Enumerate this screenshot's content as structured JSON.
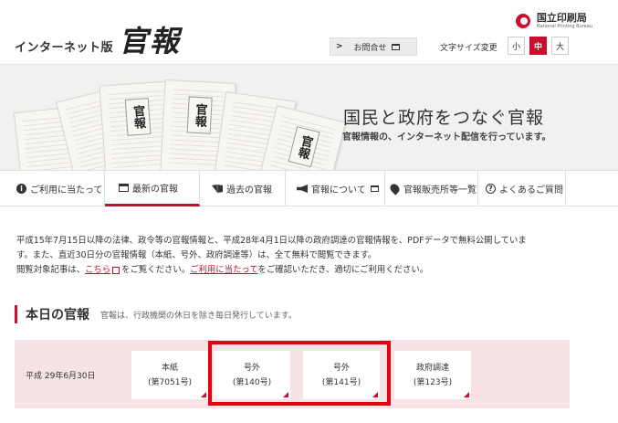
{
  "header": {
    "logo_prefix": "インターネット版",
    "logo_main": "官報",
    "npb_jp": "国立印刷局",
    "npb_en": "National Printing Bureau",
    "contact_arrow": ">",
    "contact_label": "お問合せ",
    "fontsize_label": "文字サイズ変更",
    "fontsize_options": [
      "小",
      "中",
      "大"
    ],
    "fontsize_selected": "中"
  },
  "hero": {
    "paper_title": "官報",
    "title": "国民と政府をつなぐ官報",
    "subtitle": "官報情報の、インターネット配信を行っています。"
  },
  "nav": {
    "items": [
      {
        "label": "ご利用に当たって",
        "icon": "info-icon"
      },
      {
        "label": "最新の官報",
        "icon": "newspaper-icon"
      },
      {
        "label": "過去の官報",
        "icon": "book-icon"
      },
      {
        "label": "官報について",
        "icon": "megaphone-icon"
      },
      {
        "label": "官報販売所等一覧",
        "icon": "map-pin-icon"
      },
      {
        "label": "よくあるご質問",
        "icon": "question-icon"
      }
    ]
  },
  "intro": {
    "line1": "平成15年7月15日以降の法律、政令等の官報情報と、平成28年4月1日以降の政府調達の官報情報を、PDFデータで無料公開していま",
    "line2": "す。また、直近30日分の官報情報（本紙、号外、政府調達等）は、全て無料で閲覧できます。",
    "line3_a": "閲覧対象記事は、",
    "line3_link1": "こちら",
    "line3_b": "をご覧ください。",
    "line3_link2": "ご利用に当たって",
    "line3_c": "をご確認いただき、適切にご利用ください。"
  },
  "today": {
    "title": "本日の官報",
    "note": "官報は、行政機関の休日を除き毎日発行しています。",
    "date": "平成 29年6月30日",
    "issues": [
      {
        "type": "本紙",
        "number": "(第7051号)"
      },
      {
        "type": "号外",
        "number": "(第140号)"
      },
      {
        "type": "号外",
        "number": "(第141号)"
      },
      {
        "type": "政府調達",
        "number": "(第123号)"
      }
    ]
  },
  "colors": {
    "accent": "#c8102e",
    "highlight": "#e3000f",
    "issue_bg": "#f7e3e6"
  }
}
